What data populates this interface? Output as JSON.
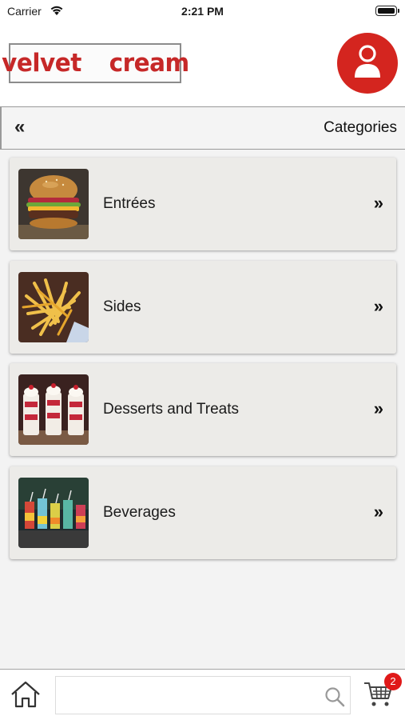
{
  "status_bar": {
    "carrier": "Carrier",
    "time": "2:21 PM"
  },
  "header": {
    "logo_text": "velvet  cream",
    "avatar_icon": "user-icon",
    "brand_color": "#c62828",
    "avatar_color": "#d4251f"
  },
  "nav": {
    "back_glyph": "«",
    "title": "Categories"
  },
  "categories": [
    {
      "label": "Entrées",
      "image": "burger-photo",
      "chevron": "»"
    },
    {
      "label": "Sides",
      "image": "fries-photo",
      "chevron": "»"
    },
    {
      "label": "Desserts and Treats",
      "image": "desserts-photo",
      "chevron": "»"
    },
    {
      "label": "Beverages",
      "image": "beverages-photo",
      "chevron": "»"
    }
  ],
  "bottom_bar": {
    "home_icon": "home-icon",
    "search_placeholder": "",
    "search_icon": "search-icon",
    "cart_icon": "cart-icon",
    "cart_count": "2",
    "badge_color": "#e01919"
  }
}
